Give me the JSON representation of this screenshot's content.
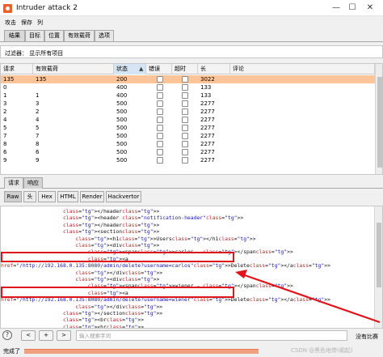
{
  "window": {
    "title": "Intruder attack 2",
    "min": "—",
    "max": "☐",
    "close": "✕"
  },
  "menu": [
    "攻击",
    "保存",
    "列"
  ],
  "tabs": [
    "结果",
    "目标",
    "位置",
    "有效载荷",
    "选项"
  ],
  "filter": {
    "text": "过滤器：  显示所有项目"
  },
  "table": {
    "headers": [
      "请求",
      "有效载荷",
      "状态",
      "错误",
      "超时",
      "长",
      "评论"
    ],
    "sort_arrow": "▲",
    "rows": [
      {
        "request": "135",
        "payload": "135",
        "status": "200",
        "error": false,
        "timeout": false,
        "length": "3022",
        "comment": "",
        "selected": true
      },
      {
        "request": "0",
        "payload": "",
        "status": "400",
        "error": false,
        "timeout": false,
        "length": "133",
        "comment": "",
        "selected": false
      },
      {
        "request": "1",
        "payload": "1",
        "status": "400",
        "error": false,
        "timeout": false,
        "length": "133",
        "comment": "",
        "selected": false
      },
      {
        "request": "3",
        "payload": "3",
        "status": "500",
        "error": false,
        "timeout": false,
        "length": "2277",
        "comment": "",
        "selected": false
      },
      {
        "request": "2",
        "payload": "2",
        "status": "500",
        "error": false,
        "timeout": false,
        "length": "2277",
        "comment": "",
        "selected": false
      },
      {
        "request": "4",
        "payload": "4",
        "status": "500",
        "error": false,
        "timeout": false,
        "length": "2277",
        "comment": "",
        "selected": false
      },
      {
        "request": "5",
        "payload": "5",
        "status": "500",
        "error": false,
        "timeout": false,
        "length": "2277",
        "comment": "",
        "selected": false
      },
      {
        "request": "7",
        "payload": "7",
        "status": "500",
        "error": false,
        "timeout": false,
        "length": "2277",
        "comment": "",
        "selected": false
      },
      {
        "request": "8",
        "payload": "8",
        "status": "500",
        "error": false,
        "timeout": false,
        "length": "2277",
        "comment": "",
        "selected": false
      },
      {
        "request": "6",
        "payload": "6",
        "status": "500",
        "error": false,
        "timeout": false,
        "length": "2277",
        "comment": "",
        "selected": false
      },
      {
        "request": "9",
        "payload": "9",
        "status": "500",
        "error": false,
        "timeout": false,
        "length": "2277",
        "comment": "",
        "selected": false
      }
    ]
  },
  "rr_tabs": [
    "请求",
    "响应"
  ],
  "view_tabs": [
    "Raw",
    "头",
    "Hex",
    "HTML",
    "Render",
    "Hackvertor"
  ],
  "code_lines": [
    "                    </header>",
    "                    <header class=\"notification-header\">",
    "                    </header>",
    "                    <section>",
    "                        <h1>Users</h1>",
    "                        <div>",
    "                            <span>carlos - </span>",
    "                            <a",
    "href=\"/http://192.168.0.135:8080/admin/delete?username=carlos\">Delete</a>",
    "                        </div>",
    "                        <div>",
    "                            <span>wiener - </span>",
    "                            <a",
    "href=\"/http://192.168.0.135:8080/admin/delete?username=wiener\">Delete</a>",
    "                        </div>",
    "                    </section>",
    "                    <br>",
    "                    <hr>"
  ],
  "search": {
    "help": "?",
    "prev": "<",
    "add": "+",
    "next": ">",
    "placeholder": "输入搜索字词",
    "matches": "没有比赛"
  },
  "status": {
    "text": "完成了",
    "progress": 1.0
  },
  "watermark": "CSDN @黑色地带(崛起)",
  "colors": {
    "accent": "#e8622d",
    "selected_row": "#ffc599",
    "highlight_box": "#e0151b",
    "progress": "#f0a07e"
  }
}
